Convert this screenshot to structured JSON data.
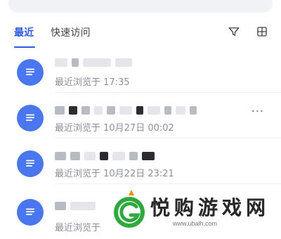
{
  "tabs": [
    {
      "label": "最近",
      "active": true
    },
    {
      "label": "快速访问",
      "active": false
    }
  ],
  "toolbar": {
    "filter_icon": "filter-icon",
    "grid_icon": "grid-view-icon"
  },
  "list": {
    "items": [
      {
        "meta": "最近浏览于 17:35",
        "has_more": false
      },
      {
        "meta": "最近浏览于 10月27日 00:02",
        "has_more": true,
        "more_label": "..."
      },
      {
        "meta": "最近浏览于 10月22日 23:21",
        "has_more": false
      },
      {
        "meta": "最近浏览于",
        "has_more": false
      }
    ]
  },
  "watermark": {
    "name": "悦购游戏网",
    "url": "www.ubalh.com"
  },
  "colors": {
    "accent": "#2d58e5",
    "doc_icon": "#4a77f0",
    "meta_text": "#8d9099",
    "badge": "#ff8a00"
  }
}
